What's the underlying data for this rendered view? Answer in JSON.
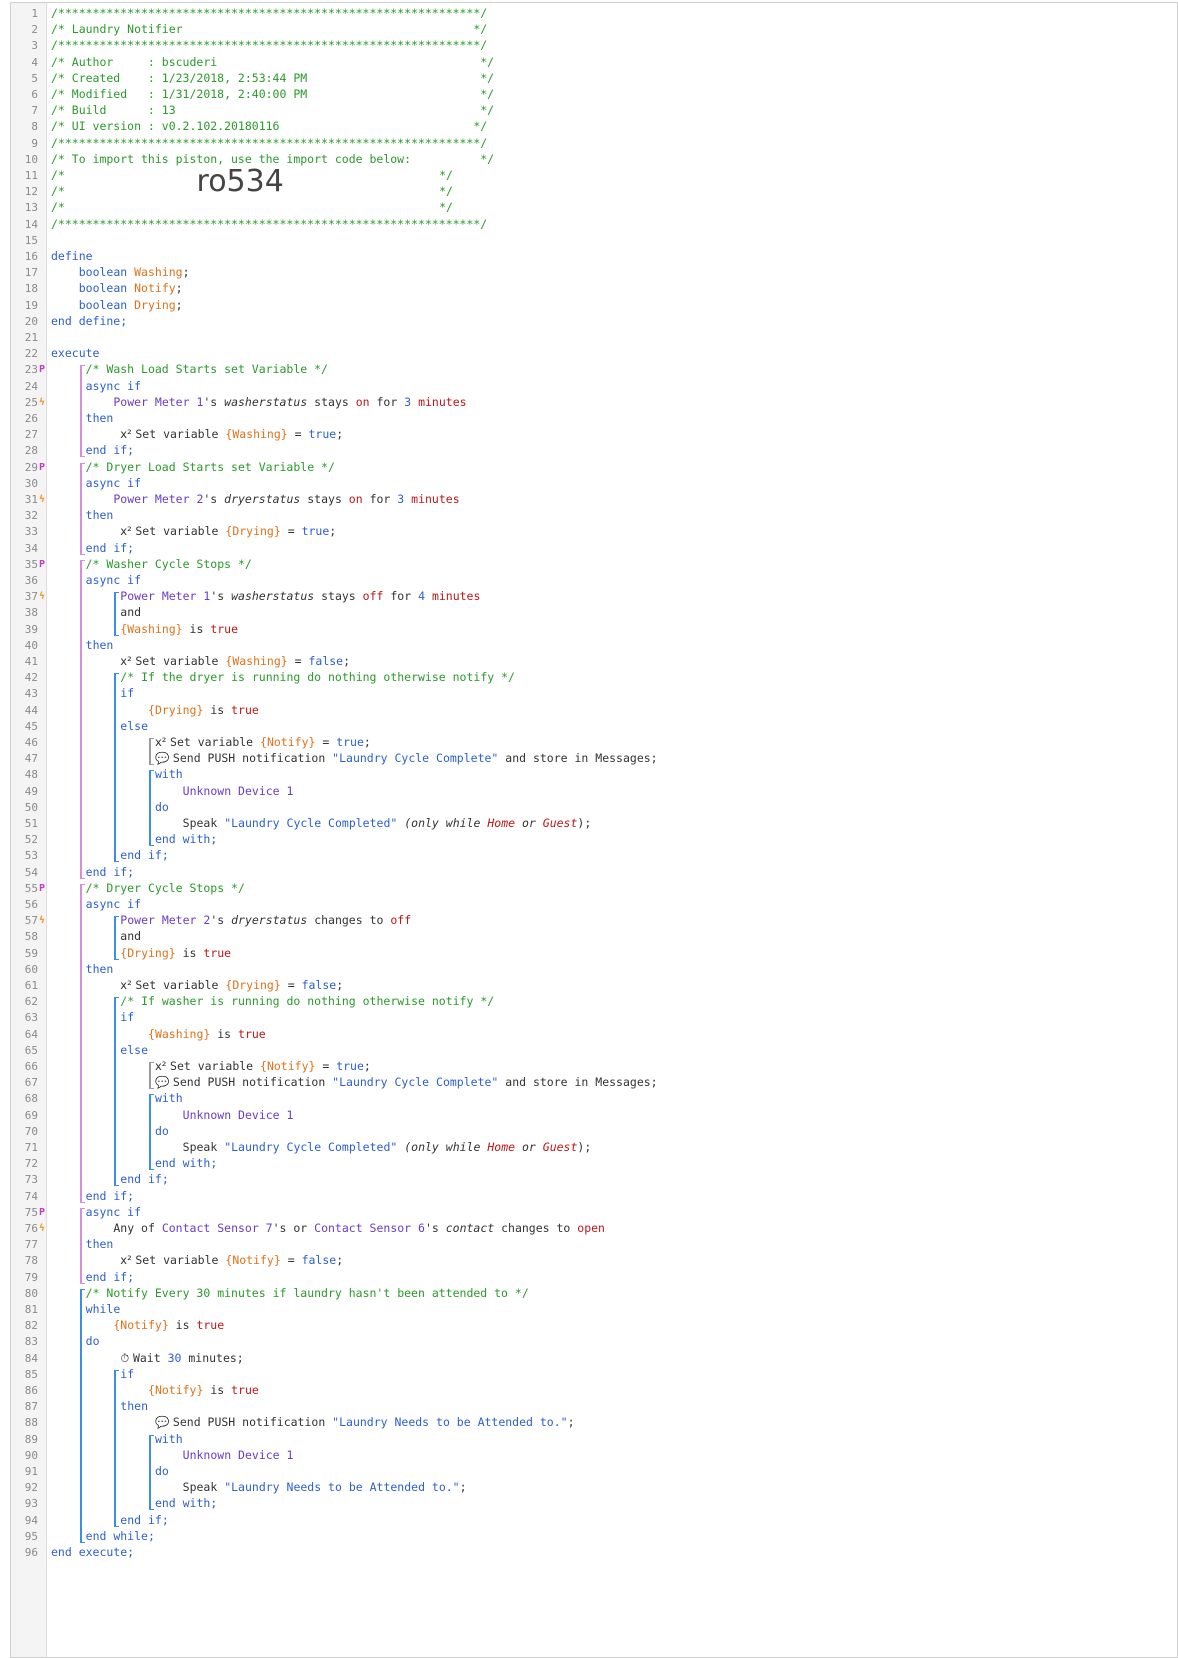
{
  "header": {
    "stars": "/*************************************************************/",
    "title_line": "/* Laundry Notifier                                          */",
    "author_line": "/* Author     : bscuderi                                      */",
    "created_line": "/* Created    : 1/23/2018, 2:53:44 PM                         */",
    "modified_line": "/* Modified   : 1/31/2018, 2:40:00 PM                         */",
    "build_line": "/* Build      : 13                                            */",
    "ui_line": "/* UI version : v0.2.102.20180116                            */",
    "import_line": "/* To import this piston, use the import code below:          */",
    "blank_open": "/*",
    "blank_close": "*/",
    "import_code": "ro534"
  },
  "code": {
    "define": "define",
    "var_type": "boolean",
    "vars": [
      "Washing",
      "Notify",
      "Drying"
    ],
    "end_define": "end define;",
    "execute": "execute",
    "end_execute": "end execute;",
    "c_wash_start": "/* Wash Load Starts set Variable */",
    "c_dry_start": "/* Dryer Load Starts set Variable */",
    "c_wash_stop": "/* Washer Cycle Stops */",
    "c_dry_stop": "/* Dryer Cycle Stops */",
    "c_dryer_running": "/* If the dryer is running do nothing otherwise notify */",
    "c_washer_running": "/* If washer is running do nothing otherwise notify */",
    "c_notify_every": "/* Notify Every 30 minutes if laundry hasn't been attended to */",
    "async_if": "async if",
    "if": "if",
    "then": "then",
    "else": "else",
    "and": "and",
    "end_if": "end if;",
    "with": "with",
    "do": "do",
    "end_with": "end with;",
    "while": "while",
    "end_while": "end while;",
    "pm1": "Power Meter 1",
    "pm2": "Power Meter 2",
    "attr_wash": "washerstatus",
    "attr_dry": "dryerstatus",
    "stays": "stays",
    "on": "on",
    "off": "off",
    "for": "for",
    "n3": "3",
    "n4": "4",
    "n30": "30",
    "minutes": "minutes",
    "is": "is",
    "true": "true",
    "false": "false",
    "changes_to": "changes to",
    "set_variable": "Set variable",
    "eq": "=",
    "send_push": "Send PUSH notification",
    "msg_complete": "\"Laundry Cycle Complete\"",
    "store": "and store in Messages;",
    "unknown_device": "Unknown Device 1",
    "speak": "Speak",
    "msg_completed": "\"Laundry Cycle Completed\"",
    "only_while": "(only while",
    "home": "Home",
    "or": "or",
    "guest": "Guest",
    "close_paren": ");",
    "any_of": "Any of",
    "cs7": "Contact Sensor 7",
    "cs6": "Contact Sensor 6",
    "contact": "contact",
    "open": "open",
    "wait": "Wait",
    "msg_attend": "\"Laundry Needs to be Attended to.\"",
    "x2": "x²"
  }
}
